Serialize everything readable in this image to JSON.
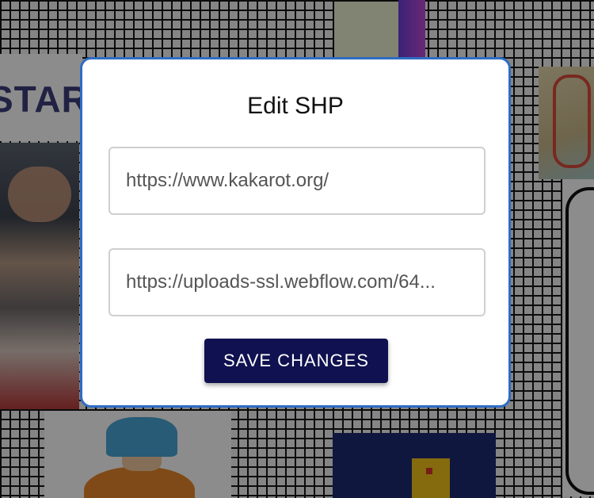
{
  "background": {
    "brand_text": "STAR"
  },
  "modal": {
    "title": "Edit SHP",
    "fields": [
      {
        "value": "https://www.kakarot.org/"
      },
      {
        "value": "https://uploads-ssl.webflow.com/64..."
      }
    ],
    "save_label": "SAVE CHANGES"
  },
  "colors": {
    "modal_border": "#2f6cc4",
    "button_bg": "#0f1150",
    "button_text": "#ffffff"
  }
}
